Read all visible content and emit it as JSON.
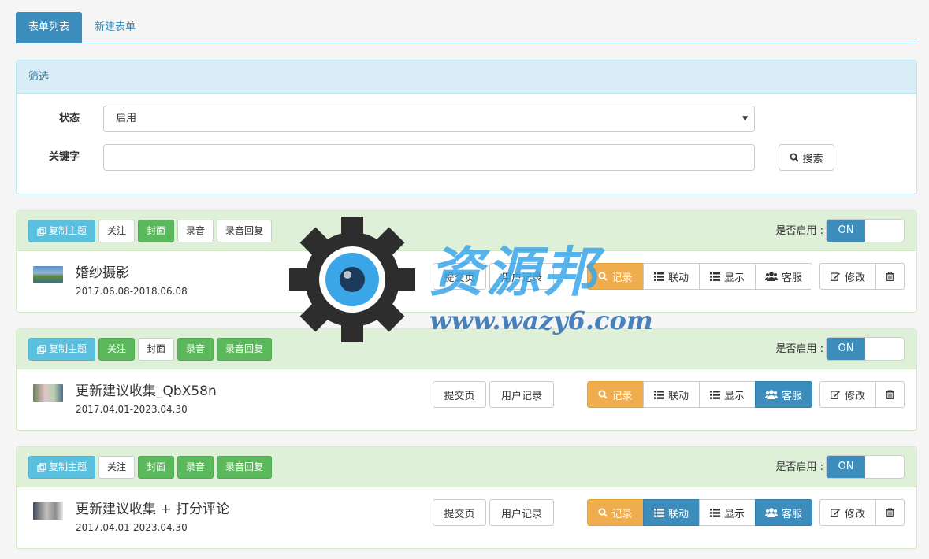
{
  "tabs": [
    {
      "label": "表单列表",
      "active": true
    },
    {
      "label": "新建表单",
      "active": false
    }
  ],
  "filter": {
    "title": "筛选",
    "status_label": "状态",
    "status_value": "启用",
    "keyword_label": "关键字",
    "keyword_value": "",
    "search_label": "搜索"
  },
  "card_labels": {
    "copy": "复制主题",
    "follow": "关注",
    "cover": "封面",
    "record_audio": "录音",
    "audio_reply": "录音回复",
    "enable_label": "是否启用 :",
    "toggle": "ON",
    "submit_page": "提交页",
    "user_records": "用户记录",
    "records": "记录",
    "linkage": "联动",
    "display": "显示",
    "service": "客服",
    "edit": "修改"
  },
  "forms": [
    {
      "title": "婚纱摄影",
      "date": "2017.06.08-2018.06.08",
      "follow_active": false,
      "cover_active": true,
      "audio_active": false,
      "reply_active": false,
      "linkage_active": false,
      "service_active": false
    },
    {
      "title": "更新建议收集_QbX58n",
      "date": "2017.04.01-2023.04.30",
      "follow_active": true,
      "cover_active": false,
      "audio_active": true,
      "reply_active": true,
      "linkage_active": false,
      "service_active": true
    },
    {
      "title": "更新建议收集 + 打分评论",
      "date": "2017.04.01-2023.04.30",
      "follow_active": false,
      "cover_active": true,
      "audio_active": true,
      "reply_active": true,
      "linkage_active": true,
      "service_active": true
    }
  ],
  "watermark": {
    "title": "资源邦",
    "url": "www.wazy6.com"
  },
  "colors": {
    "primary": "#3c8dbc",
    "success": "#5cb85c",
    "info": "#5bc0de",
    "warning": "#f0ad4e",
    "panel_green": "#dff0d8",
    "panel_blue": "#d9edf7"
  }
}
